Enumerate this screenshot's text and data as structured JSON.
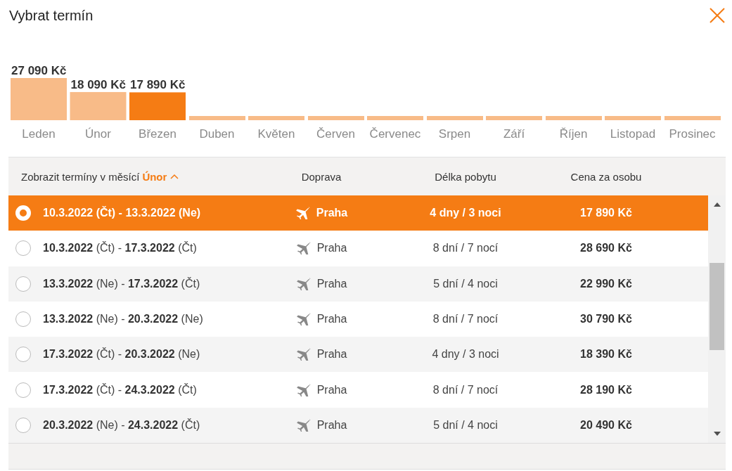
{
  "dialog": {
    "title": "Vybrat termín"
  },
  "month_chart": {
    "selected_months": [
      false,
      false,
      true,
      false,
      false,
      false,
      false,
      false,
      false,
      false,
      false,
      false
    ],
    "chart_data": {
      "type": "bar",
      "categories": [
        "Leden",
        "Únor",
        "Březen",
        "Duben",
        "Květen",
        "Červen",
        "Červenec",
        "Srpen",
        "Září",
        "Říjen",
        "Listopad",
        "Prosinec"
      ],
      "values": [
        27090,
        18090,
        17890,
        null,
        null,
        null,
        null,
        null,
        null,
        null,
        null,
        null
      ],
      "value_labels": [
        "27 090 Kč",
        "18 090 Kč",
        "17 890 Kč",
        null,
        null,
        null,
        null,
        null,
        null,
        null,
        null,
        null
      ]
    }
  },
  "table": {
    "month_filter": {
      "label": "Zobrazit termíny v měsící",
      "month": "Únor",
      "expanded": true
    },
    "columns": [
      "Doprava",
      "Délka pobytu",
      "Cena za osobu"
    ],
    "rows": [
      {
        "dates": "**10.3.2022** (Čt) - **13.3.2022** (Ne)",
        "transport": "Praha",
        "stay": "4 dny  / 3 noci",
        "price": "17 890 Kč",
        "selected": true
      },
      {
        "dates": "**10.3.2022** (Čt) - **17.3.2022** (Čt)",
        "transport": "Praha",
        "stay": "8 dní  / 7 nocí",
        "price": "28 690 Kč",
        "selected": false
      },
      {
        "dates": "**13.3.2022** (Ne) - **17.3.2022** (Čt)",
        "transport": "Praha",
        "stay": "5 dní  / 4 noci",
        "price": "22 990 Kč",
        "selected": false
      },
      {
        "dates": "**13.3.2022** (Ne) - **20.3.2022** (Ne)",
        "transport": "Praha",
        "stay": "8 dní  / 7 nocí",
        "price": "30 790 Kč",
        "selected": false
      },
      {
        "dates": "**17.3.2022** (Čt) - **20.3.2022** (Ne)",
        "transport": "Praha",
        "stay": "4 dny  / 3 noci",
        "price": "18 390 Kč",
        "selected": false
      },
      {
        "dates": "**17.3.2022** (Čt) - **24.3.2022** (Čt)",
        "transport": "Praha",
        "stay": "8 dní  / 7 nocí",
        "price": "28 190 Kč",
        "selected": false
      },
      {
        "dates": "**20.3.2022** (Ne) - **24.3.2022** (Čt)",
        "transport": "Praha",
        "stay": "5 dní  / 4 noci",
        "price": "20 490 Kč",
        "selected": false
      }
    ]
  }
}
